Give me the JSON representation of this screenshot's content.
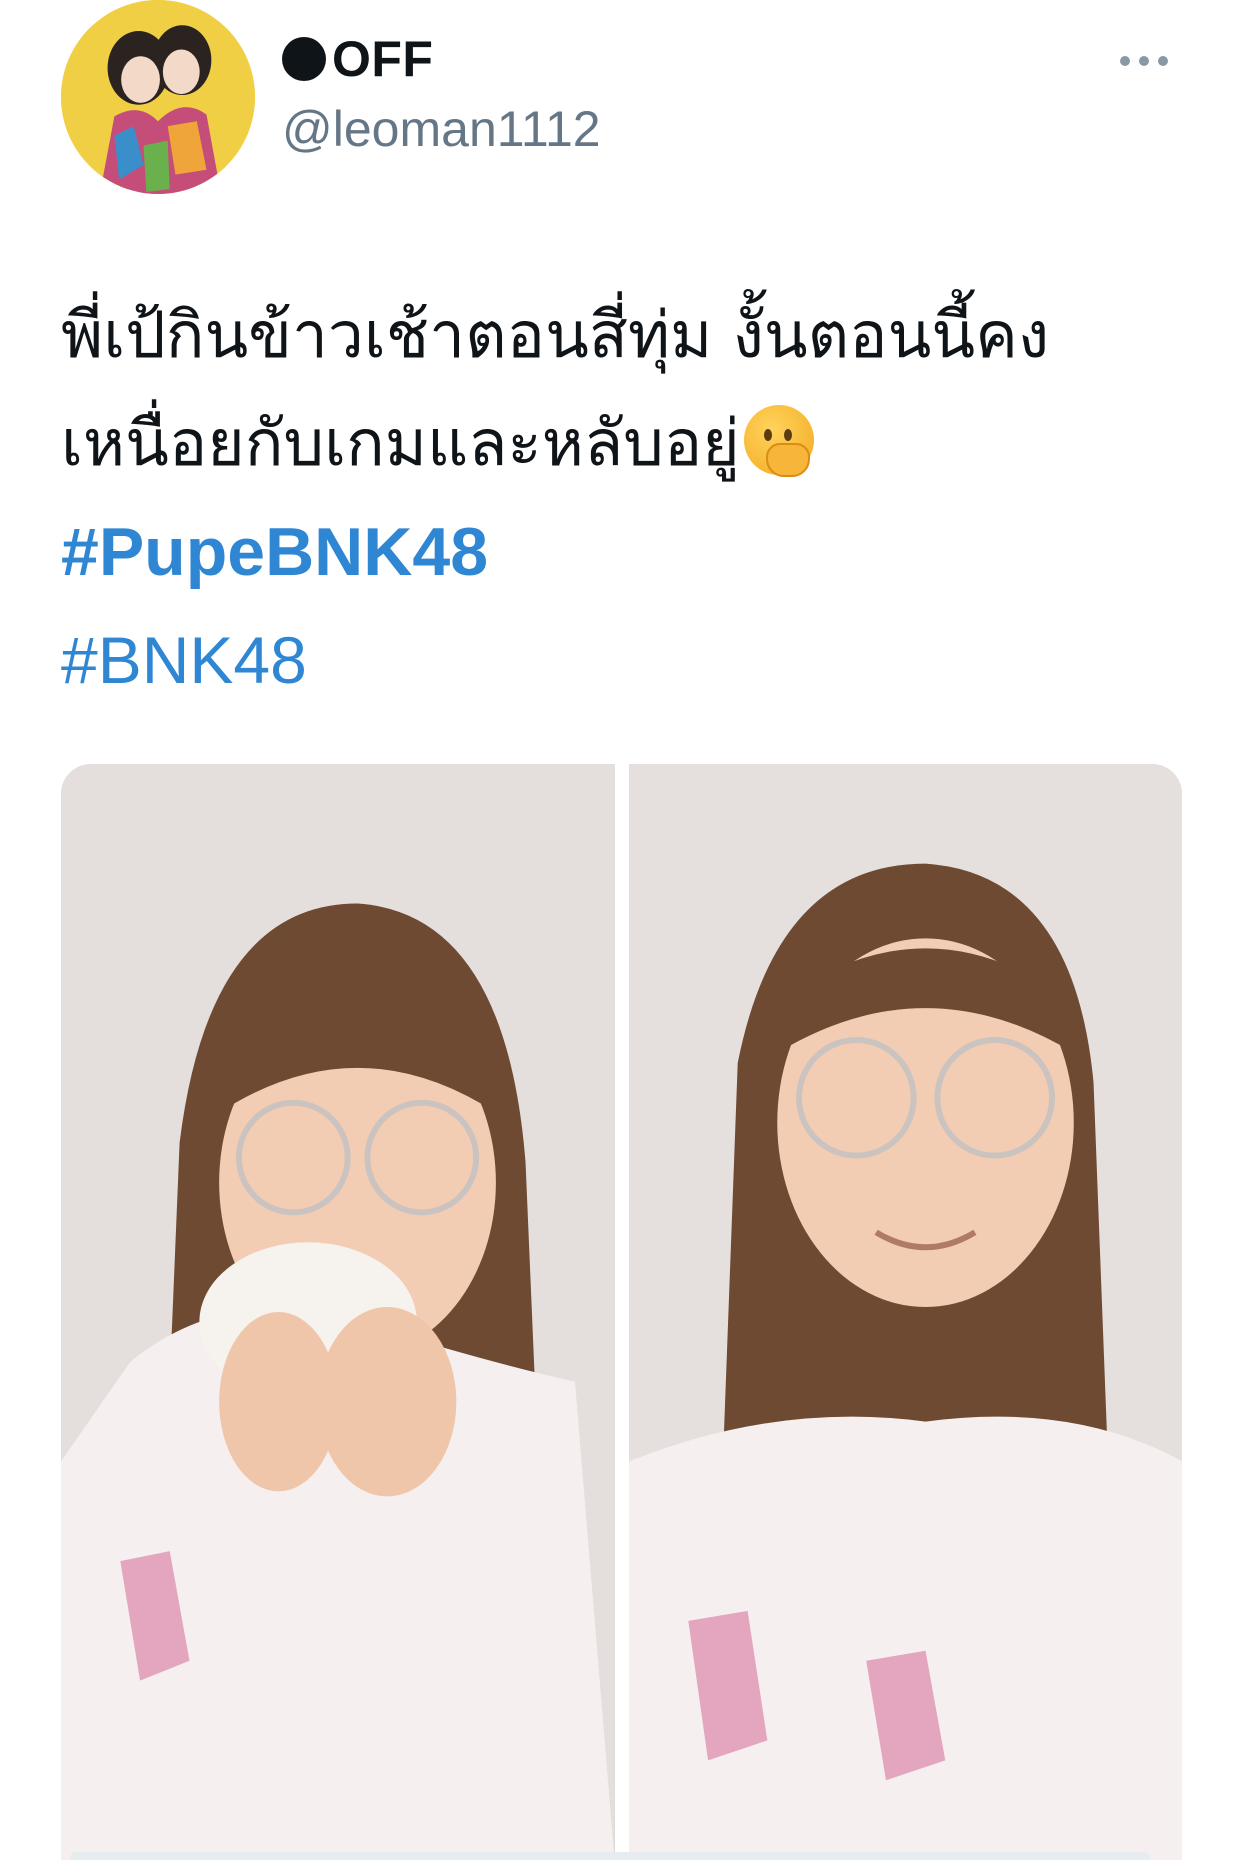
{
  "tweet": {
    "display_name": "OFF",
    "handle": "@leoman1112",
    "text_line1": "พี่เป้กินข้าวเช้าตอนสี่ทุ่ม งั้นตอนนี้คง",
    "text_line2": "เหนื่อยกับเกมและหลับอยู่",
    "hashtags": [
      "#PupeBNK48",
      "#BNK48"
    ]
  },
  "icons": {
    "more": "more-icon",
    "emoji": "hand-over-mouth-emoji"
  },
  "colors": {
    "hashtag": "#2f87d4",
    "handle": "#657786",
    "text": "#0f1419"
  }
}
